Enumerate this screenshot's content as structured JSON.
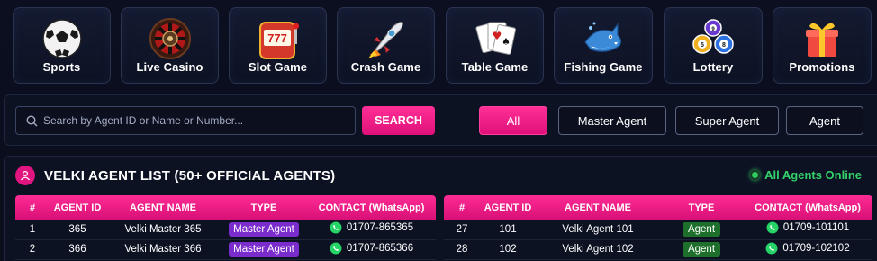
{
  "categories": [
    {
      "label": "Sports",
      "icon": "soccer-ball-icon"
    },
    {
      "label": "Live Casino",
      "icon": "roulette-wheel-icon"
    },
    {
      "label": "Slot Game",
      "icon": "slot-machine-icon"
    },
    {
      "label": "Crash Game",
      "icon": "rocket-icon"
    },
    {
      "label": "Table Game",
      "icon": "playing-cards-icon"
    },
    {
      "label": "Fishing Game",
      "icon": "shark-icon"
    },
    {
      "label": "Lottery",
      "icon": "lottery-balls-icon"
    },
    {
      "label": "Promotions",
      "icon": "gift-box-icon"
    }
  ],
  "search": {
    "placeholder": "Search by Agent ID or Name or Number...",
    "value": "",
    "button_label": "SEARCH"
  },
  "filters": [
    {
      "label": "All",
      "active": true
    },
    {
      "label": "Master Agent",
      "active": false
    },
    {
      "label": "Super Agent",
      "active": false
    },
    {
      "label": "Agent",
      "active": false
    }
  ],
  "agent_list": {
    "title": "VELKI AGENT LIST (50+ OFFICIAL AGENTS)",
    "status": "All Agents Online",
    "columns": [
      "#",
      "AGENT ID",
      "AGENT NAME",
      "TYPE",
      "CONTACT (WhatsApp)"
    ],
    "left_rows": [
      {
        "num": "1",
        "id": "365",
        "name": "Velki Master 365",
        "type": "Master Agent",
        "contact": "01707-865365"
      },
      {
        "num": "2",
        "id": "366",
        "name": "Velki Master 366",
        "type": "Master Agent",
        "contact": "01707-865366"
      }
    ],
    "right_rows": [
      {
        "num": "27",
        "id": "101",
        "name": "Velki Agent 101",
        "type": "Agent",
        "contact": "01709-101101"
      },
      {
        "num": "28",
        "id": "102",
        "name": "Velki Agent 102",
        "type": "Agent",
        "contact": "01709-102102"
      }
    ]
  },
  "colors": {
    "accent": "#e0107a",
    "master_badge": "#7b2ccc",
    "agent_badge": "#1e6f2c",
    "online": "#33d26a"
  }
}
